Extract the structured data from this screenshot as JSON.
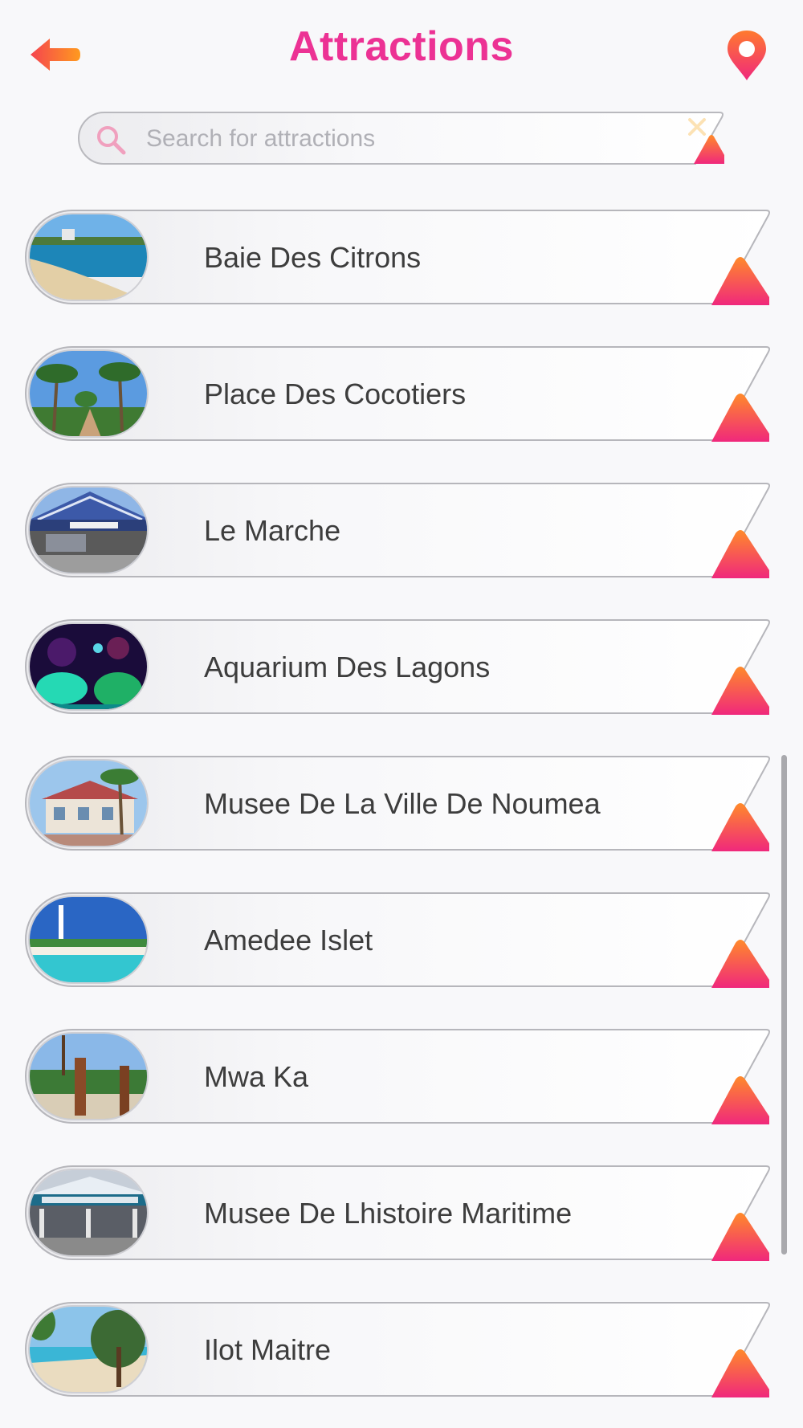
{
  "header": {
    "title": "Attractions",
    "back_icon": "arrow-left-icon",
    "location_icon": "map-pin-icon"
  },
  "search": {
    "placeholder": "Search for attractions",
    "value": "",
    "search_icon": "search-icon",
    "clear_icon": "close-icon"
  },
  "attractions": [
    {
      "label": "Baie Des Citrons",
      "image": "beach"
    },
    {
      "label": "Place Des Cocotiers",
      "image": "palm-park"
    },
    {
      "label": "Le Marche",
      "image": "market"
    },
    {
      "label": "Aquarium Des Lagons",
      "image": "aquarium"
    },
    {
      "label": "Musee De La Ville De Noumea",
      "image": "museum"
    },
    {
      "label": "Amedee Islet",
      "image": "lighthouse"
    },
    {
      "label": "Mwa Ka",
      "image": "totem"
    },
    {
      "label": "Musee De Lhistoire Maritime",
      "image": "maritime-museum"
    },
    {
      "label": "Ilot Maitre",
      "image": "islet-beach"
    }
  ],
  "colors": {
    "accent": "#ec3294",
    "back_arrow_start": "#ff9a1f",
    "back_arrow_end": "#f43a5e",
    "triangle_top": "#ff8a2a",
    "triangle_bottom": "#f0287c",
    "title": "#ec3294",
    "label_text": "#3d3d3d"
  }
}
